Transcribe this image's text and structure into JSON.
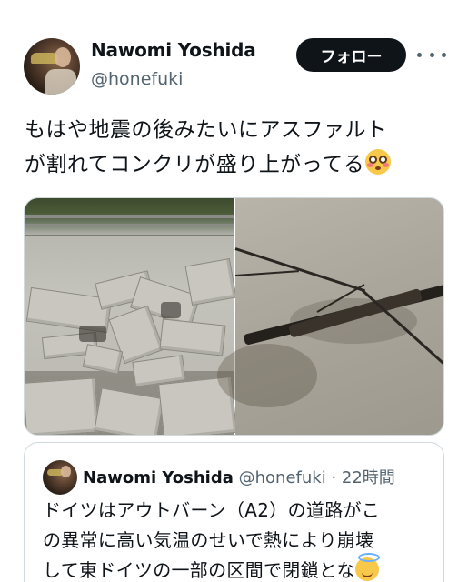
{
  "tweet": {
    "author_name": "Nawomi Yoshida",
    "author_handle": "@honefuki",
    "follow_label": "フォロー",
    "text_line1": "もはや地震の後みたいにアスファルト",
    "text_line2": "が割れてコンクリが盛り上がってる",
    "emoji": "flushed-face-emoji",
    "media": [
      {
        "description_icon": "crumbled-highway-concrete-photo"
      },
      {
        "description_icon": "cracked-asphalt-photo"
      }
    ]
  },
  "quote": {
    "author_name": "Nawomi Yoshida",
    "author_handle": "@honefuki",
    "separator": "·",
    "timestamp": "22時間",
    "text_line1": "ドイツはアウトバーン（A2）の道路がこ",
    "text_line2": "の異常に高い気温のせいで熱により崩壊",
    "text_line3": "して東ドイツの一部の区間で閉鎖とな",
    "emoji": "smiling-face-with-halo-emoji"
  },
  "colors": {
    "text_primary": "#0f1419",
    "text_secondary": "#536471",
    "button_bg": "#0f1419",
    "border": "#cfd9de"
  }
}
